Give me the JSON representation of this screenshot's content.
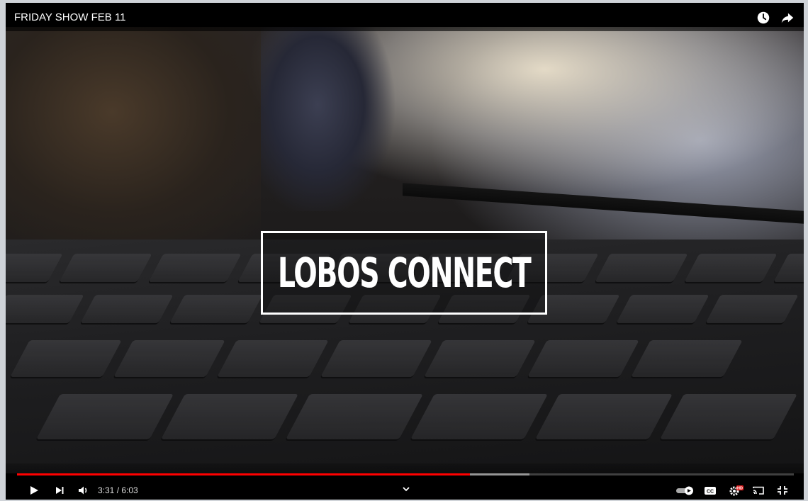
{
  "video": {
    "title": "FRIDAY SHOW FEB 11",
    "overlay_title": "LOBOS CONNECT"
  },
  "playback": {
    "current_time": "3:31",
    "duration": "6:03",
    "time_display": "3:31 / 6:03",
    "played_fraction": 0.583,
    "buffered_fraction": 0.66
  },
  "icons": {
    "top_right": [
      "watch-later-icon",
      "share-icon"
    ],
    "left_controls": [
      "play-icon",
      "next-icon",
      "volume-icon"
    ],
    "right_controls": [
      "autoplay-toggle-icon",
      "captions-icon",
      "settings-icon",
      "cast-icon",
      "exit-fullscreen-icon"
    ]
  },
  "colors": {
    "progress_played": "#ff0000",
    "settings_badge": "#e41e1e"
  },
  "captions_label": "CC",
  "settings_badge_label": "HD"
}
